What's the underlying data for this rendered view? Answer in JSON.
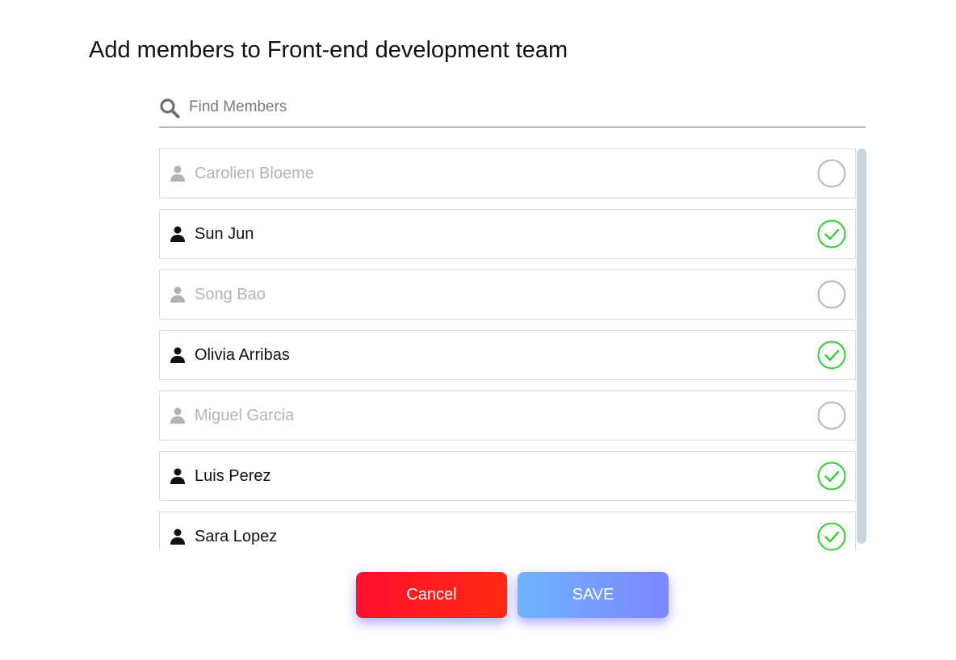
{
  "title": "Add members to Front-end development team",
  "search": {
    "placeholder": "Find Members",
    "value": "",
    "icon": "search-icon"
  },
  "members": [
    {
      "name": "Carolien Bloeme",
      "selected": false
    },
    {
      "name": "Sun Jun",
      "selected": true
    },
    {
      "name": "Song Bao",
      "selected": false
    },
    {
      "name": "Olivia Arribas",
      "selected": true
    },
    {
      "name": "Miguel Garcia",
      "selected": false
    },
    {
      "name": "Luis Perez",
      "selected": true
    },
    {
      "name": "Sara Lopez",
      "selected": true
    }
  ],
  "buttons": {
    "cancel_label": "Cancel",
    "save_label": "SAVE"
  },
  "colors": {
    "selected": "#2ecc2e",
    "unselected_circle": "#b5b5b5",
    "inactive_text": "#b3b3b3",
    "active_text": "#111111",
    "cancel": "#ff1a1a",
    "save": "#7a9cff"
  }
}
